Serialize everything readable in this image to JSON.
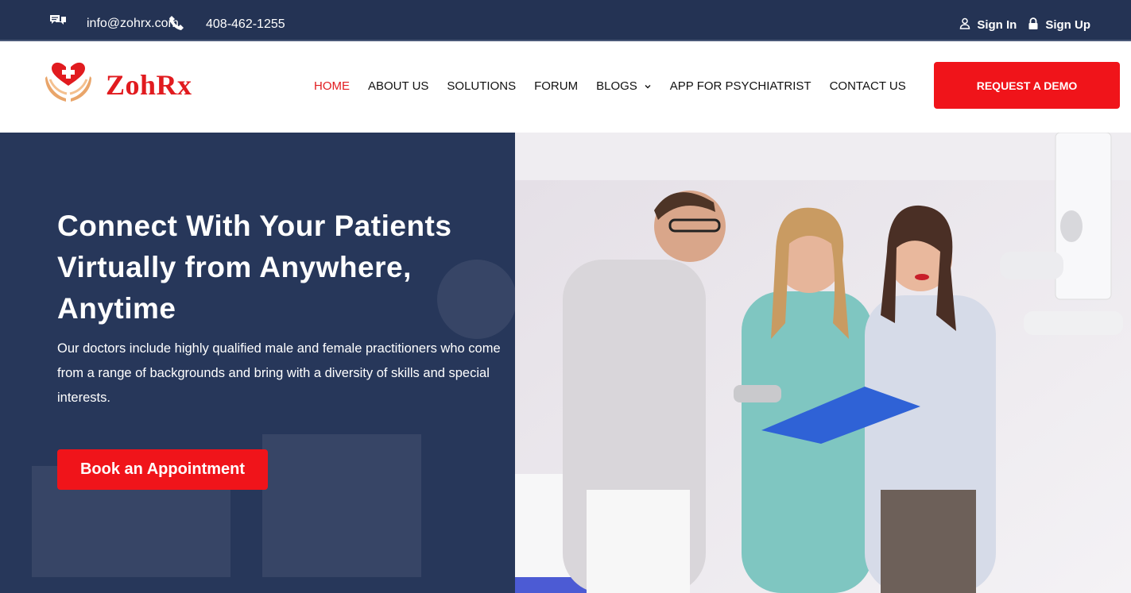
{
  "topbar": {
    "email": "info@zohrx.com",
    "phone": "408-462-1255",
    "sign_in": "Sign In",
    "sign_up": "Sign Up",
    "icons": [
      "chat-icon",
      "phone-icon",
      "user-icon",
      "lock-icon"
    ]
  },
  "header": {
    "logo_text": "ZohRx",
    "nav": [
      {
        "label": "HOME",
        "active": true
      },
      {
        "label": "ABOUT US"
      },
      {
        "label": "SOLUTIONS"
      },
      {
        "label": "FORUM"
      },
      {
        "label": "BLOGS",
        "has_dropdown": true
      },
      {
        "label": "APP FOR PSYCHIATRIST"
      },
      {
        "label": "CONTACT US"
      }
    ],
    "demo_button": "REQUEST A DEMO"
  },
  "hero": {
    "title_line1": "Connect With Your Patients",
    "title_line2": "Virtually from Anywhere,",
    "title_line3": "Anytime",
    "subtitle": "Our doctors include highly qualified male and female practitioners who come from a range of backgrounds and bring with a diversity of skills and special interests.",
    "cta": "Book an Appointment"
  },
  "colors": {
    "navy": "#243354",
    "hero_navy": "#27375a",
    "accent_red": "#f0141a",
    "brand_red": "#e11b1f"
  }
}
